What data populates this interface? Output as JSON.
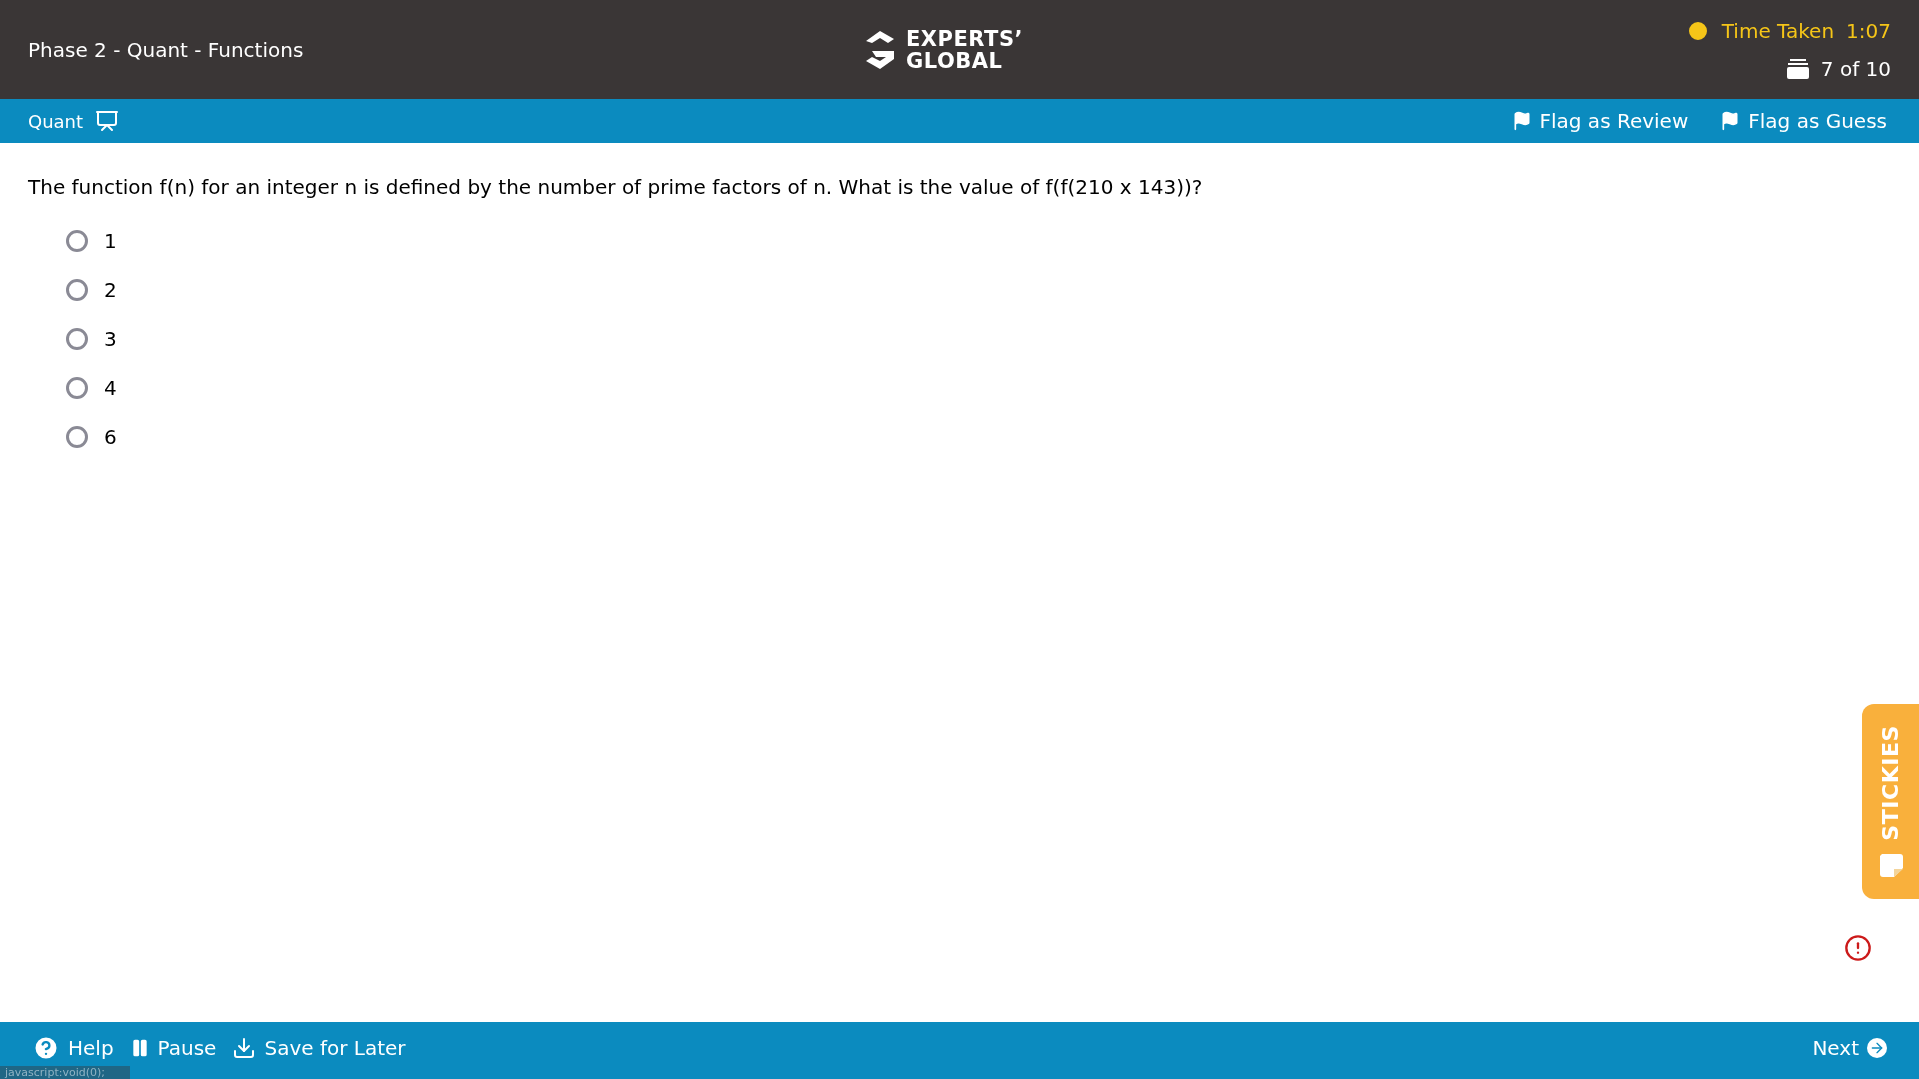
{
  "header": {
    "title": "Phase 2 - Quant - Functions",
    "logo": {
      "line1": "EXPERTS’",
      "line2": "GLOBAL"
    },
    "timer": {
      "label": "Time Taken",
      "value": "1:07"
    },
    "progress": "7 of 10"
  },
  "toolbar": {
    "section": "Quant",
    "flags": [
      {
        "label": "Flag as Review",
        "selected": false
      },
      {
        "label": "Flag as Guess",
        "selected": false
      }
    ]
  },
  "question": {
    "text": "The function f(n) for an integer n is defined by the number of prime factors of n. What is the value of f(f(210 x 143))?",
    "options": [
      {
        "label": "1",
        "selected": false
      },
      {
        "label": "2",
        "selected": false
      },
      {
        "label": "3",
        "selected": false
      },
      {
        "label": "4",
        "selected": false
      },
      {
        "label": "6",
        "selected": false
      }
    ]
  },
  "stickies": {
    "label": "STICKIES"
  },
  "footer": {
    "buttons": [
      {
        "kind": "help",
        "label": "Help"
      },
      {
        "kind": "pause",
        "label": "Pause"
      },
      {
        "kind": "save",
        "label": "Save for Later"
      }
    ],
    "next": "Next"
  },
  "status_tooltip": "javascript:void(0);"
}
